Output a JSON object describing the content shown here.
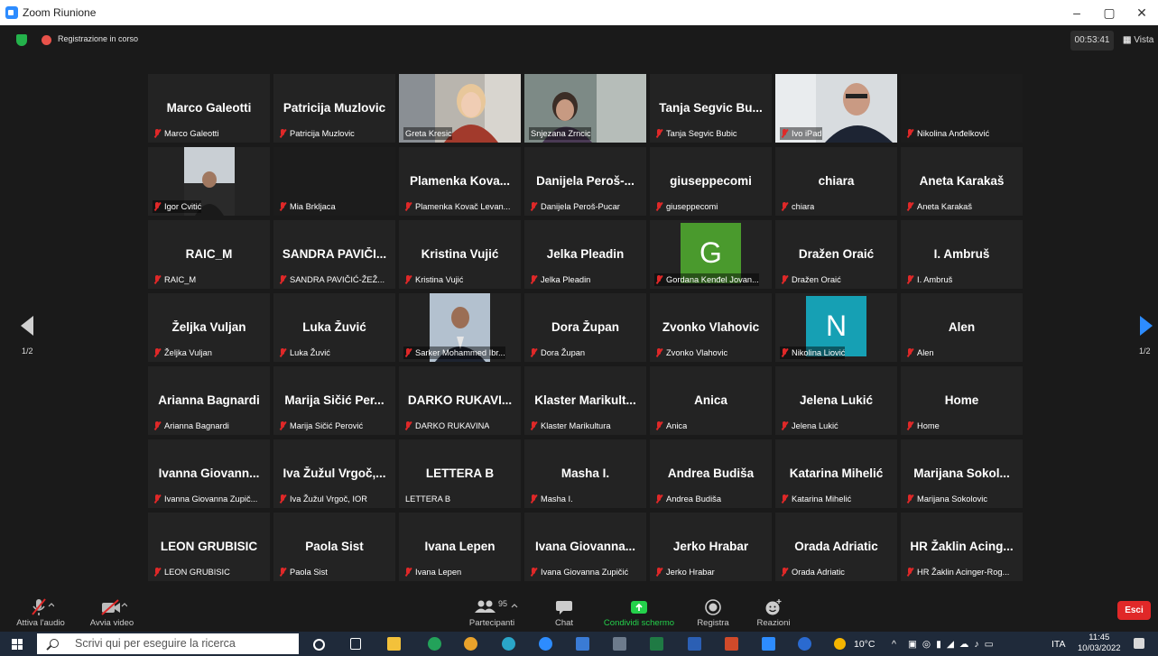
{
  "window": {
    "title": "Zoom Riunione",
    "minimize": "–",
    "restore": "▢",
    "close": "✕"
  },
  "topbar": {
    "recording": "Registrazione in corso",
    "timer": "00:53:41",
    "view_label": "Vista"
  },
  "pager": {
    "left": "1/2",
    "right": "1/2"
  },
  "tiles": [
    {
      "big": "Marco Galeotti",
      "label": "Marco Galeotti",
      "kind": "name",
      "muted": true
    },
    {
      "big": "Patricija Muzlovic",
      "label": "Patricija Muzlovic",
      "kind": "name",
      "muted": true
    },
    {
      "big": "",
      "label": "Greta Kresic",
      "kind": "photo",
      "muted": false,
      "photo": "woman-blonde"
    },
    {
      "big": "",
      "label": "Snjezana Zrncic",
      "kind": "photo",
      "muted": false,
      "photo": "woman-dark",
      "active": true
    },
    {
      "big": "Tanja Segvic Bu...",
      "label": "Tanja Segvic Bubic",
      "kind": "name",
      "muted": true
    },
    {
      "big": "",
      "label": "Ivo iPad",
      "kind": "photo",
      "muted": true,
      "photo": "man-glasses"
    },
    {
      "big": "",
      "label": "Nikolina Anđelković",
      "kind": "dark",
      "muted": true
    },
    {
      "big": "",
      "label": "Igor Cvitić",
      "kind": "photo",
      "muted": true,
      "photo": "small-man"
    },
    {
      "big": "",
      "label": "Mia Brkljaca",
      "kind": "dark",
      "muted": true
    },
    {
      "big": "Plamenka Kova...",
      "label": "Plamenka Kovač Levan...",
      "kind": "name",
      "muted": true
    },
    {
      "big": "Danijela Peroš-...",
      "label": "Danijela Peroš-Pucar",
      "kind": "name",
      "muted": true
    },
    {
      "big": "giuseppecomi",
      "label": "giuseppecomi",
      "kind": "name",
      "muted": true
    },
    {
      "big": "chiara",
      "label": "chiara",
      "kind": "name",
      "muted": true
    },
    {
      "big": "Aneta Karakaš",
      "label": "Aneta Karakaš",
      "kind": "name",
      "muted": true
    },
    {
      "big": "RAIC_M",
      "label": "RAIC_M",
      "kind": "name",
      "muted": true
    },
    {
      "big": "SANDRA PAVIČI...",
      "label": "SANDRA PAVIČIĆ-ŽEŽ...",
      "kind": "name",
      "muted": true
    },
    {
      "big": "Kristina Vujić",
      "label": "Kristina Vujić",
      "kind": "name",
      "muted": true
    },
    {
      "big": "Jelka Pleadin",
      "label": "Jelka Pleadin",
      "kind": "name",
      "muted": true
    },
    {
      "big": "G",
      "label": "Gordana Kenđel Jovan...",
      "kind": "letter",
      "muted": true,
      "color": "#4a9a2d"
    },
    {
      "big": "Dražen Oraić",
      "label": "Dražen Oraić",
      "kind": "name",
      "muted": true
    },
    {
      "big": "I. Ambruš",
      "label": "I. Ambruš",
      "kind": "name",
      "muted": true
    },
    {
      "big": "Željka Vuljan",
      "label": "Željka Vuljan",
      "kind": "name",
      "muted": true
    },
    {
      "big": "Luka Žuvić",
      "label": "Luka Žuvić",
      "kind": "name",
      "muted": true
    },
    {
      "big": "",
      "label": "Sarker Mohammed Ibr...",
      "kind": "photo",
      "muted": true,
      "photo": "man-suit"
    },
    {
      "big": "Dora Župan",
      "label": "Dora Župan",
      "kind": "name",
      "muted": true
    },
    {
      "big": "Zvonko Vlahovic",
      "label": "Zvonko Vlahovic",
      "kind": "name",
      "muted": true
    },
    {
      "big": "N",
      "label": "Nikolina Liović",
      "kind": "letter",
      "muted": true,
      "color": "#16a0b4"
    },
    {
      "big": "Alen",
      "label": "Alen",
      "kind": "name",
      "muted": true
    },
    {
      "big": "Arianna Bagnardi",
      "label": "Arianna Bagnardi",
      "kind": "name",
      "muted": true
    },
    {
      "big": "Marija Sičić Per...",
      "label": "Marija Sičić Perović",
      "kind": "name",
      "muted": true
    },
    {
      "big": "DARKO RUKAVI...",
      "label": "DARKO RUKAVINA",
      "kind": "name",
      "muted": true
    },
    {
      "big": "Klaster Marikult...",
      "label": "Klaster Marikultura",
      "kind": "name",
      "muted": true
    },
    {
      "big": "Anica",
      "label": "Anica",
      "kind": "name",
      "muted": true
    },
    {
      "big": "Jelena Lukić",
      "label": "Jelena Lukić",
      "kind": "name",
      "muted": true
    },
    {
      "big": "Home",
      "label": "Home",
      "kind": "name",
      "muted": true
    },
    {
      "big": "Ivanna Giovann...",
      "label": "Ivanna Giovanna Zupič...",
      "kind": "name",
      "muted": true
    },
    {
      "big": "Iva Žužul Vrgoč,...",
      "label": "Iva Žužul Vrgoč, IOR",
      "kind": "name",
      "muted": true
    },
    {
      "big": "LETTERA B",
      "label": "LETTERA B",
      "kind": "name",
      "muted": false
    },
    {
      "big": "Masha I.",
      "label": "Masha I.",
      "kind": "name",
      "muted": true
    },
    {
      "big": "Andrea Budiša",
      "label": "Andrea Budiša",
      "kind": "name",
      "muted": true
    },
    {
      "big": "Katarina Mihelić",
      "label": "Katarina Mihelić",
      "kind": "name",
      "muted": true
    },
    {
      "big": "Marijana Sokol...",
      "label": "Marijana Sokolovic",
      "kind": "name",
      "muted": true
    },
    {
      "big": "LEON GRUBISIC",
      "label": "LEON GRUBISIC",
      "kind": "name",
      "muted": true
    },
    {
      "big": "Paola Sist",
      "label": "Paola Sist",
      "kind": "name",
      "muted": true
    },
    {
      "big": "Ivana Lepen",
      "label": "Ivana Lepen",
      "kind": "name",
      "muted": true
    },
    {
      "big": "Ivana Giovanna...",
      "label": "Ivana Giovanna Zupičić",
      "kind": "name",
      "muted": true
    },
    {
      "big": "Jerko Hrabar",
      "label": "Jerko Hrabar",
      "kind": "name",
      "muted": true
    },
    {
      "big": "Orada Adriatic",
      "label": "Orada Adriatic",
      "kind": "name",
      "muted": true
    },
    {
      "big": "HR Žaklin Acing...",
      "label": "HR Žaklin Acinger-Rog...",
      "kind": "name",
      "muted": true
    }
  ],
  "toolbar": {
    "audio": "Attiva l'audio",
    "video": "Avvia video",
    "participants": "Partecipanti",
    "participants_count": "95",
    "chat": "Chat",
    "share": "Condividi schermo",
    "record": "Registra",
    "reactions": "Reazioni",
    "exit": "Esci",
    "share_color": "#24d14b"
  },
  "taskbar": {
    "search_placeholder": "Scrivi qui per eseguire la ricerca",
    "weather": "10°C",
    "lang": "ITA",
    "time": "11:45",
    "date": "10/03/2022"
  }
}
